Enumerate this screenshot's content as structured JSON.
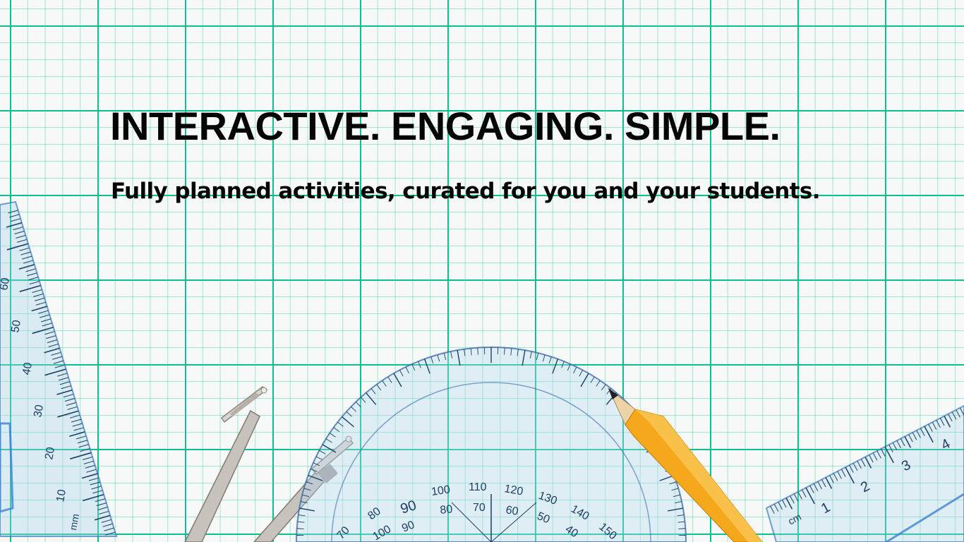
{
  "headline": "INTERACTIVE. ENGAGING. SIMPLE.",
  "subheadline": "Fully planned activities, curated for you and your students.",
  "left_ruler": {
    "unit": "mm",
    "numbers": [
      "60",
      "50",
      "40",
      "30",
      "20",
      "10"
    ]
  },
  "protractor": {
    "outer_numbers": [
      "70",
      "80",
      "90",
      "100",
      "110",
      "120",
      "130",
      "140",
      "150"
    ],
    "inner_numbers": [
      "100",
      "90",
      "80",
      "70",
      "60",
      "50",
      "40"
    ]
  },
  "right_ruler": {
    "unit": "cm",
    "numbers": [
      "1",
      "2",
      "3",
      "4"
    ]
  },
  "colors": {
    "grid": "#00be8c",
    "paper": "#f6f9f8",
    "text": "#050505",
    "pencil": "#f6a81c",
    "metal": "#c9c4bd"
  }
}
